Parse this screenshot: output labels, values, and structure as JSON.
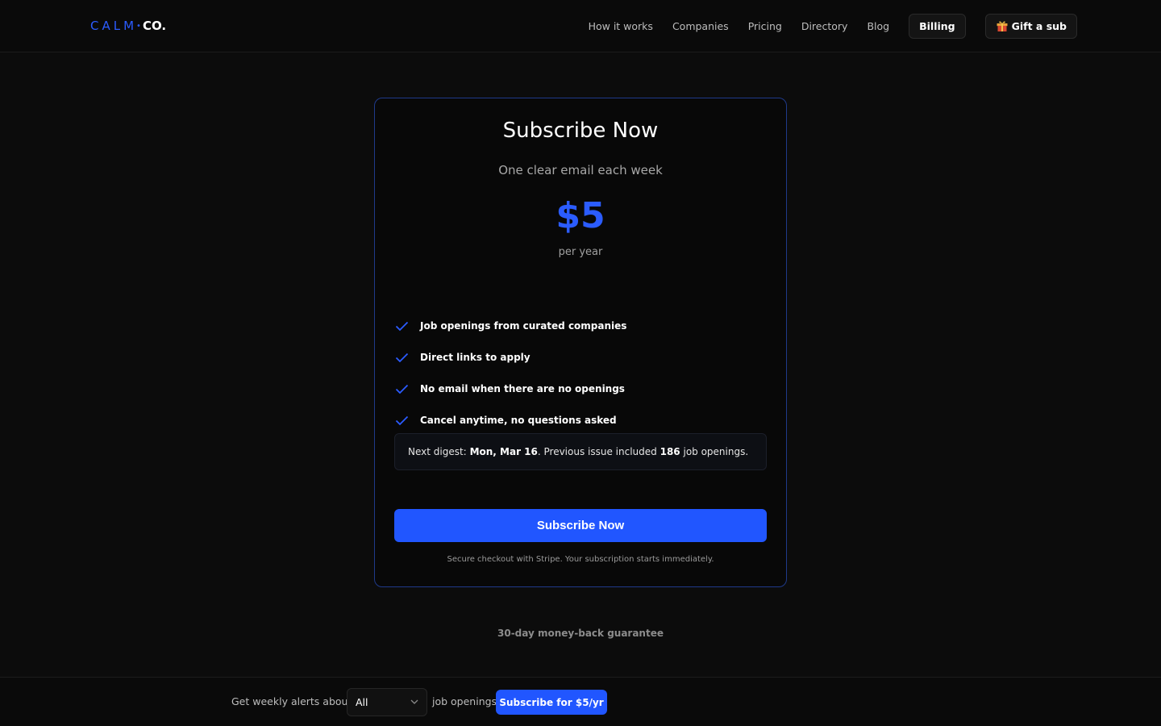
{
  "header": {
    "logo": {
      "calm": "CALM",
      "dot": "•",
      "co": "CO."
    },
    "nav": [
      "How it works",
      "Companies",
      "Pricing",
      "Directory",
      "Blog"
    ],
    "billing_label": "Billing",
    "gift_label": "Gift a sub"
  },
  "card": {
    "title": "Subscribe Now",
    "subtitle": "One clear email each week",
    "price": "$5",
    "period": "per year",
    "features": [
      "Job openings from curated companies",
      "Direct links to apply",
      "No email when there are no openings",
      "Cancel anytime, no questions asked"
    ],
    "digest": {
      "prefix": "Next digest:",
      "date": "Mon, Mar 16",
      "mid": ". Previous issue included",
      "count": "186",
      "suffix": "job openings."
    },
    "cta_label": "Subscribe Now",
    "secure_text": "Secure checkout with Stripe. Your subscription starts immediately."
  },
  "guarantee": "30-day money-back guarantee",
  "bottom_bar": {
    "text_before": "Get weekly alerts about",
    "select_value": "All",
    "text_after": "job openings",
    "button_label": "Subscribe for $5/yr"
  },
  "colors": {
    "accent": "#2156ff",
    "background": "#0c0c0c",
    "card_border": "#1f3a8a"
  },
  "icons": {
    "feature": "check-icon",
    "gift": "gift-icon",
    "select": "chevron-down-icon"
  }
}
